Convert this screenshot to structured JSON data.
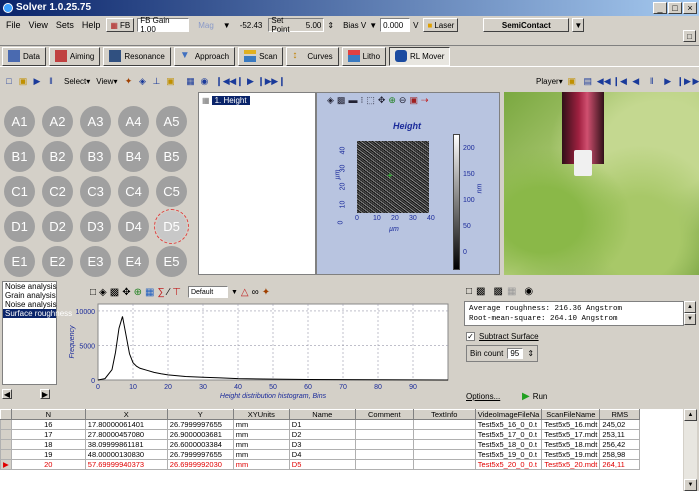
{
  "title": "Solver  1.0.25.75",
  "winbtns": [
    "_",
    "□",
    "×"
  ],
  "menu": [
    "File",
    "View",
    "Sets",
    "Help"
  ],
  "ctrl": {
    "fb_btn": "FB",
    "fb_value": "FB Gain 1.00",
    "mag_label": "Mag",
    "mag_value": "-52.43",
    "setpoint_label": "Set Point",
    "setpoint_value": "5.00",
    "bias_label": "Bias V",
    "bias_value": "0.000",
    "bias_unit": "V",
    "laser": "Laser",
    "mode": "SemiContact"
  },
  "modes": [
    "Data",
    "Aiming",
    "Resonance",
    "Approach",
    "Scan",
    "Curves",
    "Litho",
    "RL Mover"
  ],
  "toolbar2": {
    "select": "Select",
    "view": "View",
    "player": "Player"
  },
  "wells": [
    [
      "A1",
      "A2",
      "A3",
      "A4",
      "A5"
    ],
    [
      "B1",
      "B2",
      "B3",
      "B4",
      "B5"
    ],
    [
      "C1",
      "C2",
      "C3",
      "C4",
      "C5"
    ],
    [
      "D1",
      "D2",
      "D3",
      "D4",
      "D5"
    ],
    [
      "E1",
      "E2",
      "E3",
      "E4",
      "E5"
    ]
  ],
  "frames": [
    "1. Height"
  ],
  "scan": {
    "title": "Height",
    "xlabel": "µm",
    "ylabel": "µm",
    "xticks": [
      "0",
      "10",
      "20",
      "30",
      "40"
    ],
    "yticks": [
      "0",
      "10",
      "20",
      "30",
      "40"
    ],
    "cbar_ticks": [
      "200",
      "150",
      "100",
      "50",
      "0"
    ],
    "cbar_unit": "nm"
  },
  "analysis": {
    "items": [
      "Noise analysis",
      "Grain analysis",
      "Noise analysis",
      "Surface roughness"
    ],
    "selected": 3
  },
  "histo": {
    "preset": "Default",
    "xlabel": "Height distribution histogram, Bins",
    "ylabel": "Frequency",
    "yticks": [
      "10000",
      "5000",
      "0"
    ],
    "xticks": [
      "0",
      "10",
      "20",
      "30",
      "40",
      "50",
      "60",
      "70",
      "80",
      "90"
    ]
  },
  "chart_data": {
    "type": "line",
    "title": "",
    "xlabel": "Height distribution histogram, Bins",
    "ylabel": "Frequency",
    "xlim": [
      0,
      100
    ],
    "ylim": [
      0,
      11000
    ],
    "x": [
      0,
      2,
      4,
      5,
      6,
      7,
      8,
      9,
      10,
      11,
      12,
      14,
      16,
      18,
      20,
      25,
      30,
      35,
      40,
      50,
      60,
      70,
      80,
      90,
      100
    ],
    "y": [
      0,
      200,
      1500,
      4000,
      7500,
      9200,
      6500,
      3800,
      2500,
      2000,
      1700,
      1400,
      1100,
      900,
      750,
      500,
      400,
      300,
      200,
      120,
      80,
      60,
      40,
      20,
      0
    ]
  },
  "roughness": {
    "line1": "Average roughness: 216.36 Angstrom",
    "line2": "Root-mean-square: 264.10 Angstrom",
    "subtract": "Subtract Surface",
    "bincount_label": "Bin count",
    "bincount_value": "95",
    "options": "Options...",
    "run": "Run"
  },
  "table": {
    "columns": [
      "N",
      "X",
      "Y",
      "XYUnits",
      "Name",
      "Comment",
      "TextInfo",
      "VideoImageFileNa",
      "ScanFileName",
      "RMS"
    ],
    "rows": [
      [
        "16",
        "17.80000061401",
        "26.7999997655",
        "mm",
        "D1",
        "",
        "",
        "Test5x5_16_0_0.t",
        "Test5x5_16.mdt",
        "245,02"
      ],
      [
        "17",
        "27.80000457080",
        "26.9000003681",
        "mm",
        "D2",
        "",
        "",
        "Test5x5_17_0_0.t",
        "Test5x5_17.mdt",
        "253,11"
      ],
      [
        "18",
        "38.09999861181",
        "26.6000003384",
        "mm",
        "D3",
        "",
        "",
        "Test5x5_18_0_0.t",
        "Test5x5_18.mdt",
        "256,42"
      ],
      [
        "19",
        "48.00000130830",
        "26.7999997655",
        "mm",
        "D4",
        "",
        "",
        "Test5x5_19_0_0.t",
        "Test5x5_19.mdt",
        "258,98"
      ],
      [
        "20",
        "57.69999940373",
        "26.6999992030",
        "mm",
        "D5",
        "",
        "",
        "Test5x5_20_0_0.t",
        "Test5x5_20.mdt",
        "264,11"
      ]
    ]
  }
}
